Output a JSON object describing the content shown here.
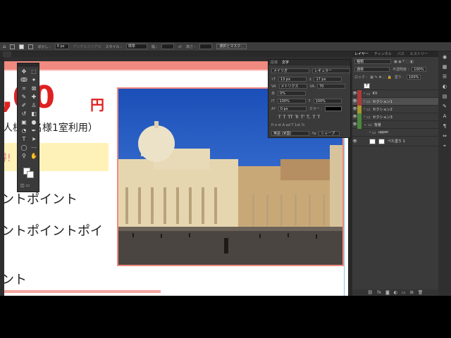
{
  "options_bar": {
    "feather_label": "ぼかし :",
    "feather_value": "0 px",
    "antialias_label": "アンチエイリアス",
    "style_label": "スタイル :",
    "style_value": "標準",
    "width_label": "幅 :",
    "height_label": "高さ :",
    "select_mask_label": "選択とマスク..."
  },
  "document": {
    "price": ",00",
    "price_unit": "円",
    "subtitle": "人様（名様1室利用）",
    "highlight_text": "得!",
    "line1": "ントポイント",
    "line2": "ントポイントポイ",
    "line3": "ント"
  },
  "char_panel": {
    "tabs": [
      "段落",
      "文字"
    ],
    "font": "メイリオ",
    "weight": "レギュラー",
    "size": "13 px",
    "leading": "17 px",
    "kerning": "メトリクス",
    "tracking": "70",
    "tsume": "0%",
    "v_scale": "100%",
    "h_scale": "100%",
    "baseline": "0 px",
    "color_label": "カラー :",
    "styles": [
      "T",
      "T",
      "TT",
      "Tr",
      "T'",
      "T,",
      "T",
      "T"
    ],
    "lang": "英語 (米国)",
    "aa": "シャープ"
  },
  "layers_panel": {
    "tabs": [
      "レイヤー",
      "チャンネル",
      "パス",
      "ヒストリー"
    ],
    "kind": "種類",
    "blend": "通常",
    "opacity_label": "不透明度 :",
    "opacity": "100%",
    "lock_label": "ロック :",
    "fill_label": "塗り :",
    "fill": "100%",
    "layers": [
      {
        "name": "",
        "type": "text",
        "visible": false,
        "tag": "none"
      },
      {
        "name": "KV",
        "type": "folder",
        "visible": true,
        "tag": "red"
      },
      {
        "name": "セクション1",
        "type": "folder",
        "visible": true,
        "tag": "red"
      },
      {
        "name": "セクション2",
        "type": "folder",
        "visible": true,
        "tag": "yellow"
      },
      {
        "name": "セクション3",
        "type": "folder",
        "visible": true,
        "tag": "green"
      },
      {
        "name": "背景",
        "type": "folder",
        "visible": true,
        "tag": "green"
      },
      {
        "name": "upper",
        "type": "folder",
        "visible": false,
        "tag": "none"
      },
      {
        "name": "べた塗り 1",
        "type": "fill",
        "visible": true,
        "tag": "none"
      }
    ]
  },
  "colors": {
    "accent_red": "#e02020",
    "band_pink": "#f08a80",
    "highlight_yellow": "#fff2b8",
    "tag_red": "#b13a3a",
    "tag_yellow": "#a89a2c",
    "tag_green": "#4a8a3a"
  }
}
